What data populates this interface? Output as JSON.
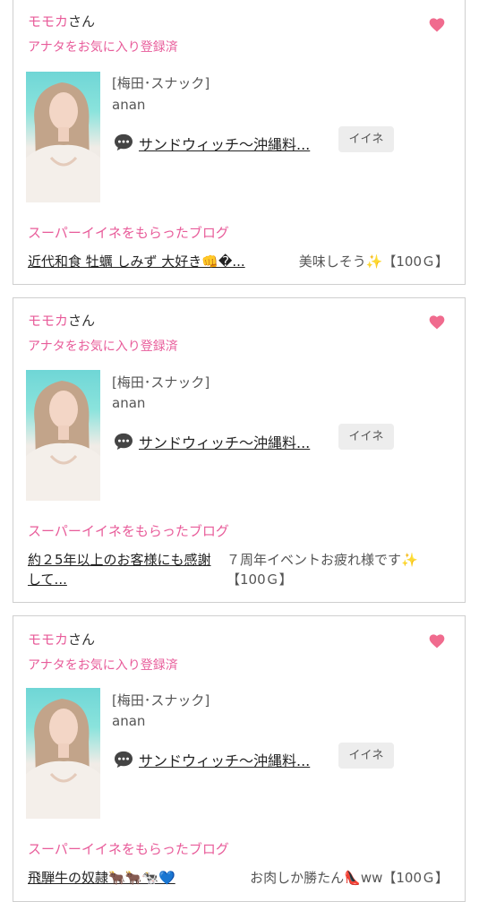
{
  "cards": [
    {
      "name": "モモカ",
      "honorific": "さん",
      "favorite_status": "アナタをお気に入り登録済",
      "shop": "[梅田･スナック]",
      "cast": "anan",
      "blog_title": "サンドウィッチ〜沖縄料...",
      "iine_label": "イイネ",
      "section_title": "スーパーイイネをもらったブログ",
      "super_blog": "近代和食 牡蠣 しみず 大好き👊�...",
      "comment": "美味しそう✨【100Ｇ】"
    },
    {
      "name": "モモカ",
      "honorific": "さん",
      "favorite_status": "アナタをお気に入り登録済",
      "shop": "[梅田･スナック]",
      "cast": "anan",
      "blog_title": "サンドウィッチ〜沖縄料...",
      "iine_label": "イイネ",
      "section_title": "スーパーイイネをもらったブログ",
      "super_blog": "約２5年以上のお客様にも感謝して...",
      "comment": "７周年イベントお疲れ様です✨【100Ｇ】"
    },
    {
      "name": "モモカ",
      "honorific": "さん",
      "favorite_status": "アナタをお気に入り登録済",
      "shop": "[梅田･スナック]",
      "cast": "anan",
      "blog_title": "サンドウィッチ〜沖縄料...",
      "iine_label": "イイネ",
      "section_title": "スーパーイイネをもらったブログ",
      "super_blog": "飛騨牛の奴隷🐂🐂🐄💙",
      "comment": "お肉しか勝たん👠ww【100Ｇ】"
    }
  ],
  "colors": {
    "accent": "#e85c9a",
    "heart": "#f06b8e",
    "button_bg": "#ededed",
    "border": "#cfcfcf"
  }
}
